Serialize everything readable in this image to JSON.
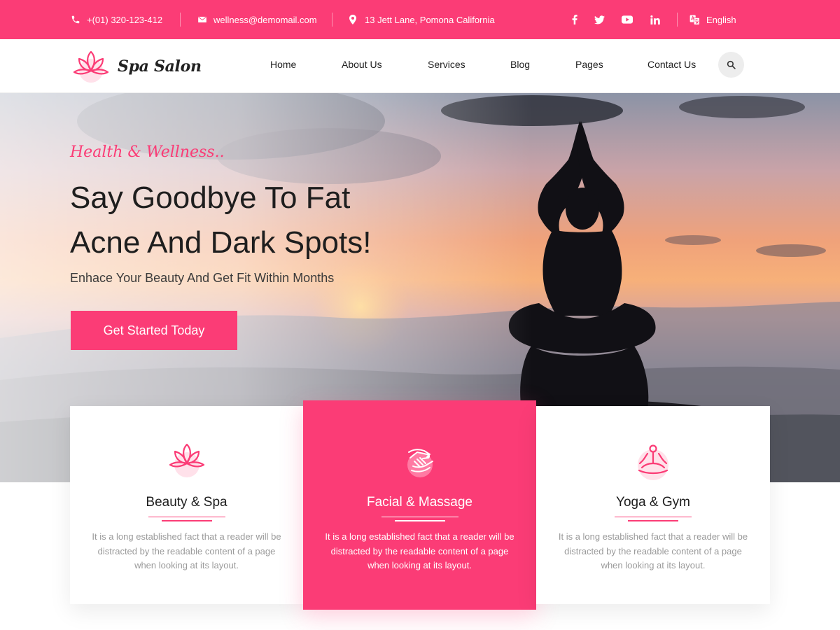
{
  "topbar": {
    "phone": "+(01) 320-123-412",
    "email": "wellness@demomail.com",
    "address": "13 Jett Lane, Pomona California",
    "language": "English",
    "social_icons": [
      "facebook-icon",
      "twitter-icon",
      "youtube-icon",
      "linkedin-icon"
    ]
  },
  "header": {
    "logo_text": "Spa Salon",
    "nav": [
      "Home",
      "About Us",
      "Services",
      "Blog",
      "Pages",
      "Contact Us"
    ]
  },
  "hero": {
    "kicker": "Health & Wellness..",
    "title_line1": "Say Goodbye To Fat",
    "title_line2": "Acne And Dark Spots!",
    "subtitle": "Enhace Your Beauty And Get Fit Within Months",
    "cta": "Get Started Today"
  },
  "services": [
    {
      "title": "Beauty & Spa",
      "text": "It is a long established fact that a reader will be distracted by the readable content of a page when looking at its layout.",
      "icon": "lotus-icon",
      "active": false
    },
    {
      "title": "Facial & Massage",
      "text": "It is a long established fact that a reader will be distracted by the readable content of a page when looking at its layout.",
      "icon": "massage-hands-icon",
      "active": true
    },
    {
      "title": "Yoga & Gym",
      "text": "It is a long established fact that a reader will be distracted by the readable content of a page when looking at its layout.",
      "icon": "meditation-icon",
      "active": false
    }
  ],
  "colors": {
    "accent": "#fb3c76",
    "text_dark": "#1e1e1e",
    "text_muted": "#9a9a9a",
    "search_bg": "#ededed"
  }
}
